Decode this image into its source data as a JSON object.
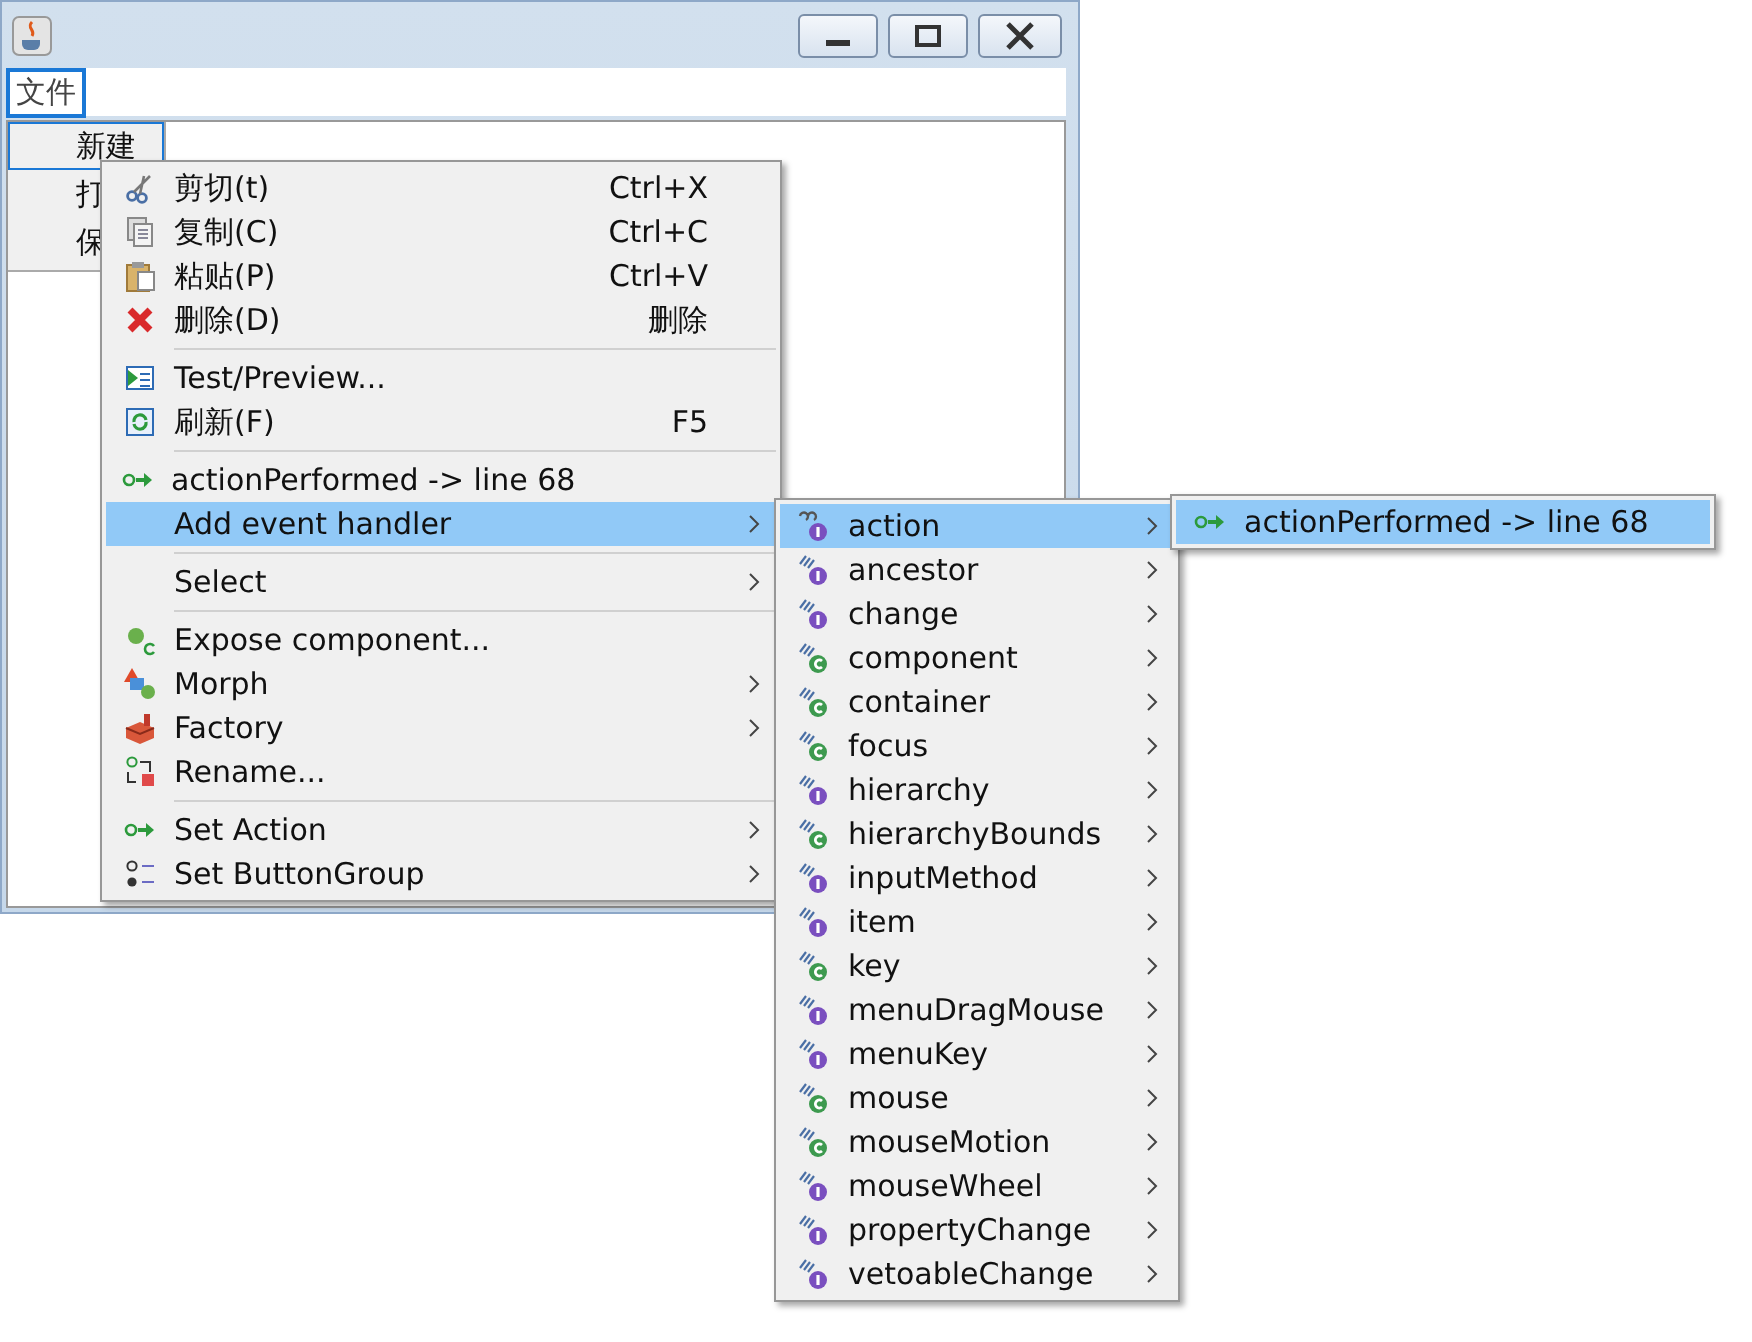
{
  "window": {
    "menu_bar": [
      {
        "label": "文件",
        "selected": true
      }
    ],
    "list": [
      {
        "label": "新建",
        "selected": true
      },
      {
        "label": "打",
        "selected": false
      },
      {
        "label": "保",
        "selected": false
      }
    ]
  },
  "context_menu": {
    "groups": [
      [
        {
          "label": "剪切(t)",
          "shortcut": "Ctrl+X",
          "submenu": false,
          "selected": false
        },
        {
          "label": "复制(C)",
          "shortcut": "Ctrl+C",
          "submenu": false,
          "selected": false
        },
        {
          "label": "粘贴(P)",
          "shortcut": "Ctrl+V",
          "submenu": false,
          "selected": false
        },
        {
          "label": "删除(D)",
          "shortcut": "删除",
          "submenu": false,
          "selected": false
        }
      ],
      [
        {
          "label": "Test/Preview...",
          "submenu": false,
          "selected": false
        },
        {
          "label": "刷新(F)",
          "shortcut": "F5",
          "submenu": false,
          "selected": false
        }
      ],
      [
        {
          "label": "actionPerformed -> line 68",
          "submenu": false,
          "selected": false
        },
        {
          "label": "Add event handler",
          "submenu": true,
          "selected": true
        }
      ],
      [
        {
          "label": "Select",
          "submenu": true,
          "selected": false
        }
      ],
      [
        {
          "label": "Expose component...",
          "submenu": false,
          "selected": false
        },
        {
          "label": "Morph",
          "submenu": true,
          "selected": false
        },
        {
          "label": "Factory",
          "submenu": true,
          "selected": false
        },
        {
          "label": "Rename...",
          "submenu": false,
          "selected": false
        }
      ],
      [
        {
          "label": "Set Action",
          "submenu": true,
          "selected": false
        },
        {
          "label": "Set ButtonGroup",
          "submenu": true,
          "selected": false
        }
      ]
    ]
  },
  "event_menu": {
    "items": [
      {
        "label": "action",
        "kind": "linked",
        "selected": true
      },
      {
        "label": "ancestor",
        "kind": "interface",
        "selected": false
      },
      {
        "label": "change",
        "kind": "interface",
        "selected": false
      },
      {
        "label": "component",
        "kind": "class",
        "selected": false
      },
      {
        "label": "container",
        "kind": "class",
        "selected": false
      },
      {
        "label": "focus",
        "kind": "class",
        "selected": false
      },
      {
        "label": "hierarchy",
        "kind": "interface",
        "selected": false
      },
      {
        "label": "hierarchyBounds",
        "kind": "class",
        "selected": false
      },
      {
        "label": "inputMethod",
        "kind": "interface",
        "selected": false
      },
      {
        "label": "item",
        "kind": "interface",
        "selected": false
      },
      {
        "label": "key",
        "kind": "class",
        "selected": false
      },
      {
        "label": "menuDragMouse",
        "kind": "interface",
        "selected": false
      },
      {
        "label": "menuKey",
        "kind": "interface",
        "selected": false
      },
      {
        "label": "mouse",
        "kind": "class",
        "selected": false
      },
      {
        "label": "mouseMotion",
        "kind": "class",
        "selected": false
      },
      {
        "label": "mouseWheel",
        "kind": "interface",
        "selected": false
      },
      {
        "label": "propertyChange",
        "kind": "interface",
        "selected": false
      },
      {
        "label": "vetoableChange",
        "kind": "interface",
        "selected": false
      }
    ]
  },
  "method_menu": {
    "items": [
      {
        "label": "actionPerformed -> line 68",
        "selected": true
      }
    ]
  }
}
